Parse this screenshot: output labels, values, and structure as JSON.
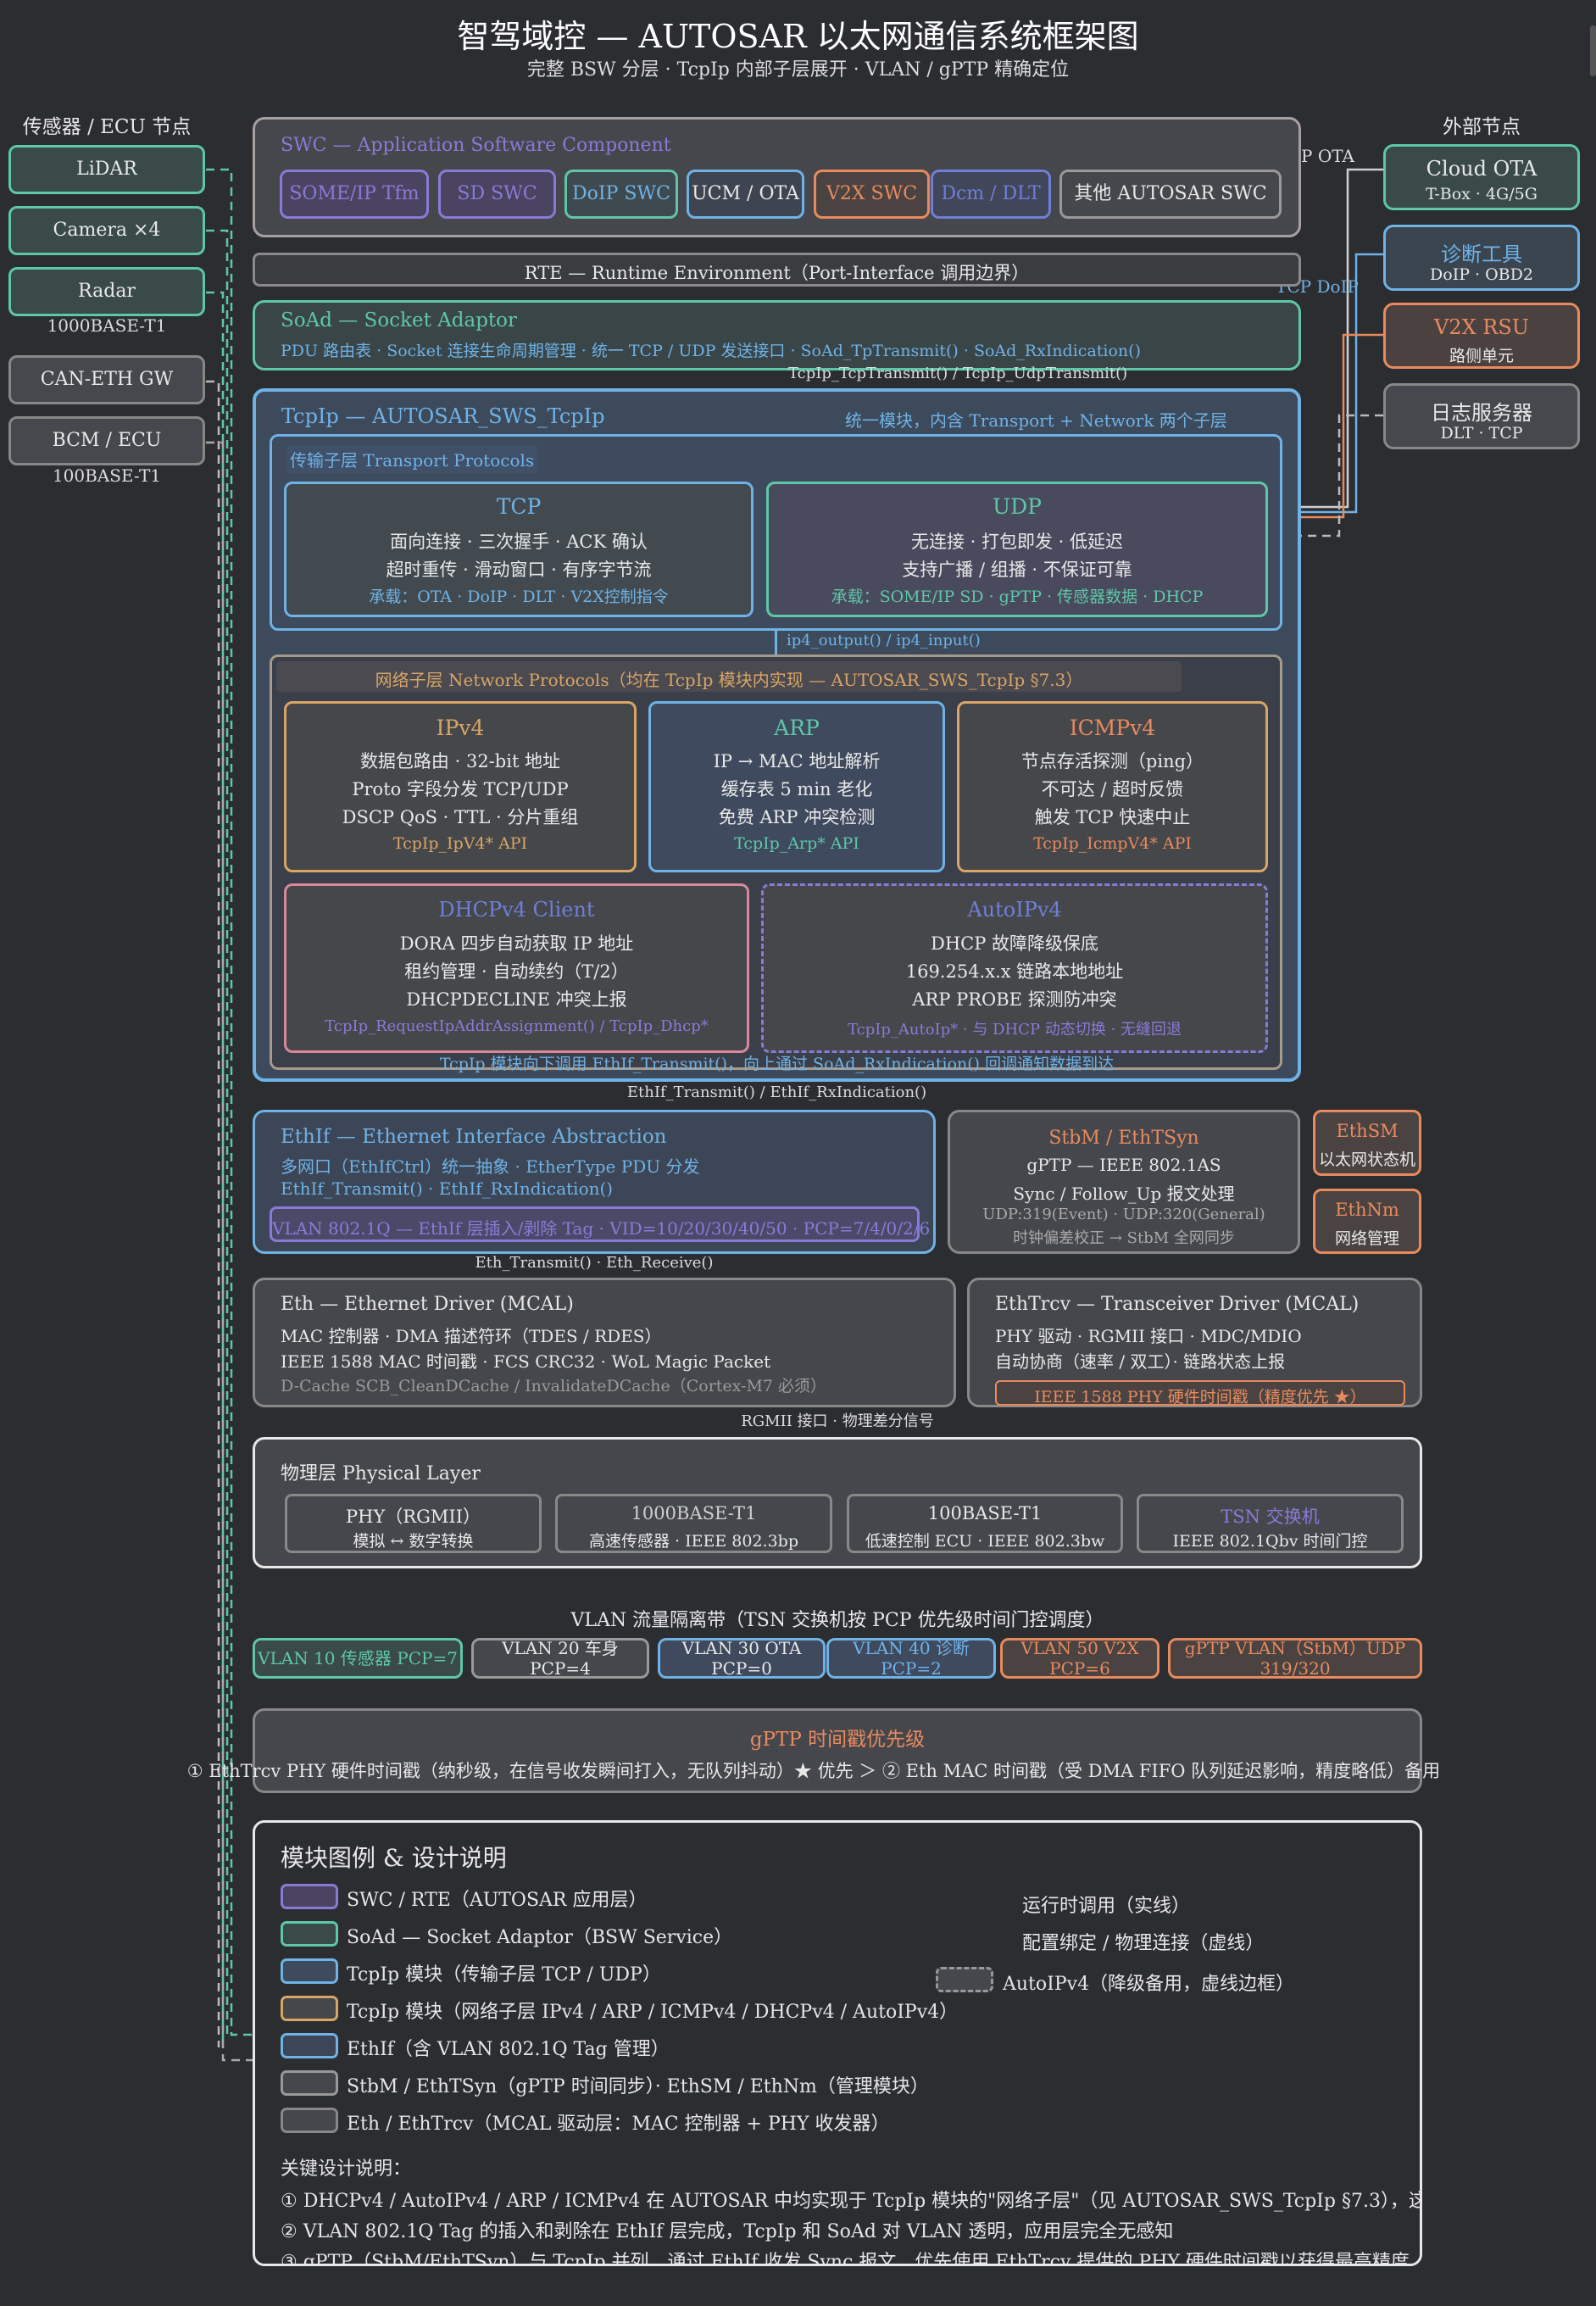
{
  "header": {
    "title": "智驾域控 — AUTOSAR 以太网通信系统框架图",
    "subtitle": "完整 BSW 分层 · TcpIp 内部子层展开 · VLAN / gPTP 精确定位"
  },
  "left": {
    "heading": "传感器 / ECU 节点",
    "nodes": [
      "LiDAR",
      "Camera ×4",
      "Radar",
      "CAN-ETH GW",
      "BCM / ECU"
    ],
    "note1": "1000BASE-T1",
    "note2": "100BASE-T1"
  },
  "right": {
    "heading": "外部节点",
    "nodes": [
      {
        "name": "Cloud OTA",
        "sub": "T-Box · 4G/5G"
      },
      {
        "name": "诊断工具",
        "sub": "DoIP · OBD2"
      },
      {
        "name": "V2X RSU",
        "sub": "路侧单元"
      },
      {
        "name": "日志服务器",
        "sub": "DLT · TCP"
      }
    ],
    "edge_ota": "P OTA",
    "edge_doip": "TCP DoIP"
  },
  "swc": {
    "title": "SWC — Application Software Component",
    "items": [
      "SOME/IP Tfm",
      "SD SWC",
      "DoIP SWC",
      "UCM / OTA",
      "V2X SWC",
      "Dcm / DLT",
      "其他 AUTOSAR SWC"
    ]
  },
  "rte": {
    "label": "RTE — Runtime Environment（Port-Interface 调用边界）"
  },
  "soad": {
    "title": "SoAd — Socket Adaptor",
    "desc": "PDU 路由表 · Socket 连接生命周期管理 · 统一 TCP / UDP 发送接口 · SoAd_TpTransmit() · SoAd_RxIndication()",
    "edge": "TcpIp_TcpTransmit() / TcpIp_UdpTransmit()"
  },
  "tcpip": {
    "title": "TcpIp — AUTOSAR_SWS_TcpIp",
    "note": "统一模块，内含 Transport + Network 两个子层",
    "transport_title": "传输子层 Transport Protocols",
    "tcp": {
      "name": "TCP",
      "l1": "面向连接 · 三次握手 · ACK 确认",
      "l2": "超时重传 · 滑动窗口 · 有序字节流",
      "l3": "承载：OTA · DoIP · DLT · V2X控制指令"
    },
    "udp": {
      "name": "UDP",
      "l1": "无连接 · 打包即发 · 低延迟",
      "l2": "支持广播 / 组播 · 不保证可靠",
      "l3": "承载：SOME/IP SD · gPTP · 传感器数据 · DHCP"
    },
    "ip_edge": "ip4_output() / ip4_input()",
    "network_title": "网络子层 Network Protocols（均在 TcpIp 模块内实现 — AUTOSAR_SWS_TcpIp §7.3）",
    "ipv4": {
      "name": "IPv4",
      "l1": "数据包路由 · 32-bit 地址",
      "l2": "Proto 字段分发 TCP/UDP",
      "l3": "DSCP QoS · TTL · 分片重组",
      "api": "TcpIp_IpV4* API"
    },
    "arp": {
      "name": "ARP",
      "l1": "IP → MAC 地址解析",
      "l2": "缓存表 5 min 老化",
      "l3": "免费 ARP 冲突检测",
      "api": "TcpIp_Arp* API"
    },
    "icmp": {
      "name": "ICMPv4",
      "l1": "节点存活探测（ping）",
      "l2": "不可达 / 超时反馈",
      "l3": "触发 TCP 快速中止",
      "api": "TcpIp_IcmpV4* API"
    },
    "dhcp": {
      "name": "DHCPv4 Client",
      "l1": "DORA 四步自动获取 IP 地址",
      "l2": "租约管理 · 自动续约（T/2）",
      "l3": "DHCPDECLINE 冲突上报",
      "api": "TcpIp_RequestIpAddrAssignment() / TcpIp_Dhcp*"
    },
    "autoip": {
      "name": "AutoIPv4",
      "l1": "DHCP 故障降级保底",
      "l2": "169.254.x.x 链路本地地址",
      "l3": "ARP PROBE 探测防冲突",
      "api": "TcpIp_AutoIp* · 与 DHCP 动态切换 · 无缝回退"
    },
    "bottom_note": "TcpIp 模块向下调用 EthIf_Transmit()，向上通过 SoAd_RxIndication() 回调通知数据到达",
    "edge": "EthIf_Transmit() / EthIf_RxIndication()"
  },
  "ethif": {
    "title": "EthIf — Ethernet Interface Abstraction",
    "l1": "多网口（EthIfCtrl）统一抽象 · EtherType PDU 分发",
    "l2": "EthIf_Transmit() · EthIf_RxIndication()",
    "vlan": "VLAN 802.1Q — EthIf 层插入/剥除 Tag · VID=10/20/30/40/50 · PCP=7/4/0/2/6",
    "edge": "Eth_Transmit() · Eth_Receive()"
  },
  "stbm": {
    "title": "StbM / EthTSyn",
    "l1": "gPTP — IEEE 802.1AS",
    "l2": "Sync / Follow_Up 报文处理",
    "l3": "UDP:319(Event) · UDP:320(General)",
    "l4": "时钟偏差校正 → StbM 全网同步"
  },
  "ethsm": {
    "name": "EthSM",
    "sub": "以太网状态机"
  },
  "ethnm": {
    "name": "EthNm",
    "sub": "网络管理"
  },
  "eth": {
    "title": "Eth — Ethernet Driver (MCAL)",
    "l1": "MAC 控制器 · DMA 描述符环（TDES / RDES）",
    "l2": "IEEE 1588 MAC 时间戳 · FCS CRC32 · WoL Magic Packet",
    "l3": "D-Cache SCB_CleanDCache / InvalidateDCache（Cortex-M7 必须）"
  },
  "ethtrcv": {
    "title": "EthTrcv — Transceiver Driver (MCAL)",
    "l1": "PHY 驱动 · RGMII 接口 · MDC/MDIO",
    "l2": "自动协商（速率 / 双工）· 链路状态上报",
    "badge": "IEEE 1588 PHY 硬件时间戳（精度优先 ★）"
  },
  "rgmii_edge": "RGMII 接口 · 物理差分信号",
  "phy": {
    "title": "物理层 Physical Layer",
    "items": [
      {
        "name": "PHY（RGMII）",
        "sub": "模拟 ↔ 数字转换"
      },
      {
        "name": "1000BASE-T1",
        "sub": "高速传感器 · IEEE 802.3bp"
      },
      {
        "name": "100BASE-T1",
        "sub": "低速控制 ECU · IEEE 802.3bw"
      },
      {
        "name": "TSN 交换机",
        "sub": "IEEE 802.1Qbv 时间门控"
      }
    ]
  },
  "vlan": {
    "title": "VLAN 流量隔离带（TSN 交换机按 PCP 优先级时间门控调度）",
    "items": [
      "VLAN 10 传感器 PCP=7",
      "VLAN 20 车身 PCP=4",
      "VLAN 30 OTA PCP=0",
      "VLAN 40 诊断 PCP=2",
      "VLAN 50 V2X PCP=6",
      "gPTP VLAN（StbM）UDP 319/320"
    ]
  },
  "gptp": {
    "title": "gPTP 时间戳优先级",
    "desc": "① EthTrcv PHY 硬件时间戳（纳秒级，在信号收发瞬间打入，无队列抖动）★ 优先 ＞ ② Eth MAC 时间戳（受 DMA FIFO 队列延迟影响，精度略低）备用"
  },
  "legend": {
    "title": "模块图例 & 设计说明",
    "items": [
      "SWC / RTE（AUTOSAR 应用层）",
      "SoAd — Socket Adaptor（BSW Service）",
      "TcpIp 模块（传输子层 TCP / UDP）",
      "TcpIp 模块（网络子层 IPv4 / ARP / ICMPv4 / DHCPv4 / AutoIPv4）",
      "EthIf（含 VLAN 802.1Q Tag 管理）",
      "StbM / EthTSyn（gPTP 时间同步）· EthSM / EthNm（管理模块）",
      "Eth / EthTrcv（MCAL 驱动层：MAC 控制器 + PHY 收发器）"
    ],
    "line_solid": "运行时调用（实线）",
    "line_dash": "配置绑定 / 物理连接（虚线）",
    "autoip": "AutoIPv4（降级备用，虚线边框）",
    "notes_title": "关键设计说明：",
    "notes": [
      "① DHCPv4 / AutoIPv4 / ARP / ICMPv4 在 AUTOSAR 中均实现于 TcpIp 模块的\"网络子层\"（见 AUTOSAR_SWS_TcpIp §7.3），这是规范将 DHCP 归为网",
      "② VLAN 802.1Q Tag 的插入和剥除在 EthIf 层完成，TcpIp 和 SoAd 对 VLAN 透明，应用层完全无感知",
      "③ gPTP（StbM/EthTSyn）与 TcpIp 并列，通过 EthIf 收发 Sync 报文，优先使用 EthTrcv 提供的 PHY 硬件时间戳以获得最高精度"
    ]
  },
  "colors": {
    "bg": "#2b2d30",
    "teal": "#5ec7a8",
    "blue": "#6fb2e6",
    "purple": "#8a7ad8",
    "orange": "#e98a5e",
    "gold": "#d9a566",
    "pink": "#d9879a"
  }
}
